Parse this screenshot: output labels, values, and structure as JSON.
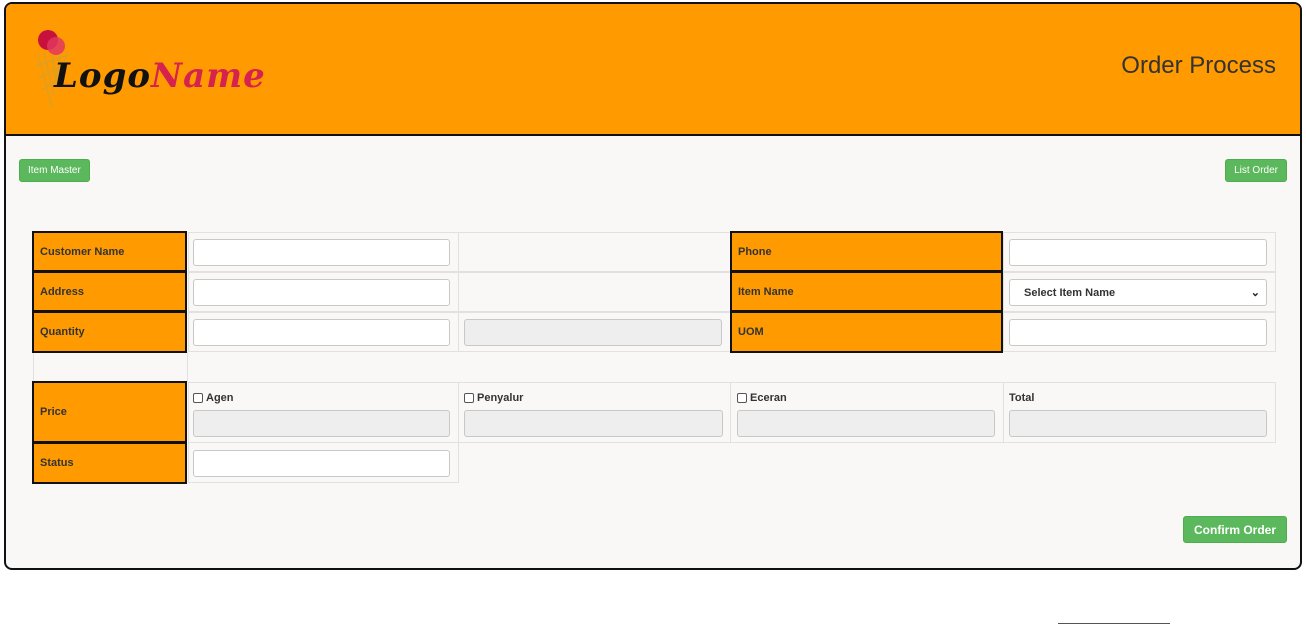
{
  "header": {
    "logo_text_1": "Logo",
    "logo_text_2": "Name",
    "title": "Order Process",
    "header_color": "#ff9b00"
  },
  "toolbar": {
    "item_master": "Item Master",
    "list_order": "List Order"
  },
  "form": {
    "customer_name": "Customer Name",
    "address": "Address",
    "quantity": "Quantity",
    "phone": "Phone",
    "item_name": "Item Name",
    "uom": "UOM",
    "item_select_value": "Select Item Name",
    "price": "Price",
    "status": "Status",
    "agen": "Agen",
    "penyalur": "Penyalur",
    "eceran": "Eceran",
    "total": "Total"
  },
  "actions": {
    "confirm": "Confirm Order",
    "button_color": "#5cb85c"
  }
}
